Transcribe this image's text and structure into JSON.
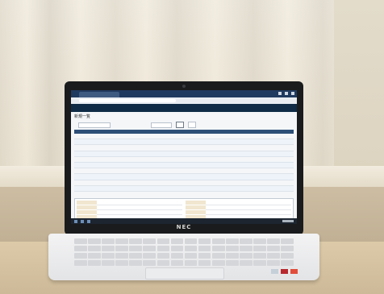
{
  "laptop": {
    "brand": "NEC"
  },
  "screen": {
    "page_title": "新規一覧",
    "table": {
      "row_count_visible": 10
    }
  },
  "colors": {
    "app_header": "#0f2b46",
    "table_header": "#2d4f77",
    "curtain": "#ebe3d1",
    "desk": "#dccaa8"
  }
}
